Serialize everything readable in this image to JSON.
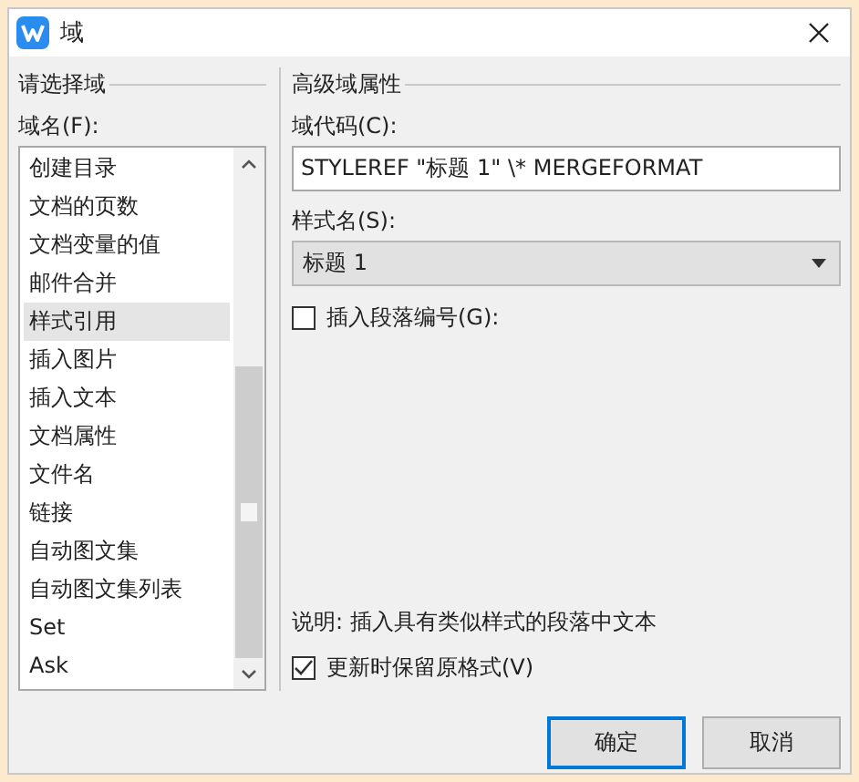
{
  "window": {
    "title": "域"
  },
  "left": {
    "group_title": "请选择域",
    "list_label": "域名(F):",
    "items": [
      {
        "label": "创建目录",
        "selected": false
      },
      {
        "label": "文档的页数",
        "selected": false
      },
      {
        "label": "文档变量的值",
        "selected": false
      },
      {
        "label": "邮件合并",
        "selected": false
      },
      {
        "label": "样式引用",
        "selected": true
      },
      {
        "label": "插入图片",
        "selected": false
      },
      {
        "label": "插入文本",
        "selected": false
      },
      {
        "label": "文档属性",
        "selected": false
      },
      {
        "label": "文件名",
        "selected": false
      },
      {
        "label": "链接",
        "selected": false
      },
      {
        "label": "自动图文集",
        "selected": false
      },
      {
        "label": "自动图文集列表",
        "selected": false
      },
      {
        "label": "Set",
        "selected": false
      },
      {
        "label": "Ask",
        "selected": false
      }
    ]
  },
  "right": {
    "group_title": "高级域属性",
    "code_label": "域代码(C):",
    "code_value": "STYLEREF \"标题 1\" \\* MERGEFORMAT",
    "style_label": "样式名(S):",
    "style_value": "标题 1",
    "number_option": {
      "label": "插入段落编号(G):",
      "checked": false
    },
    "description": "说明: 插入具有类似样式的段落中文本",
    "preserve_option": {
      "label": "更新时保留原格式(V)",
      "checked": true
    }
  },
  "buttons": [
    {
      "label": "确定",
      "default": true
    },
    {
      "label": "取消",
      "default": false
    }
  ]
}
